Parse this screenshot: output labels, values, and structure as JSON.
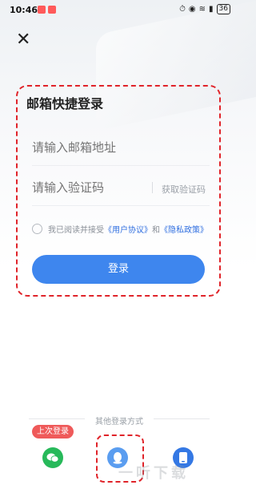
{
  "status": {
    "time": "10:46",
    "battery": "36"
  },
  "title": "邮箱快捷登录",
  "email": {
    "placeholder": "请输入邮箱地址"
  },
  "code": {
    "placeholder": "请输入验证码",
    "get_code": "获取验证码"
  },
  "agreement": {
    "prefix": "我已阅读并接受",
    "user_agreement": "《用户协议》",
    "and": "和",
    "privacy": "《隐私政策》"
  },
  "login_button": "登录",
  "other_methods": "其他登录方式",
  "last_login_badge": "上次登录",
  "watermark": "一听下载",
  "colors": {
    "primary": "#3e86ee",
    "highlight": "#e0242a",
    "wechat": "#27b95a",
    "link": "#2f6fe0"
  }
}
